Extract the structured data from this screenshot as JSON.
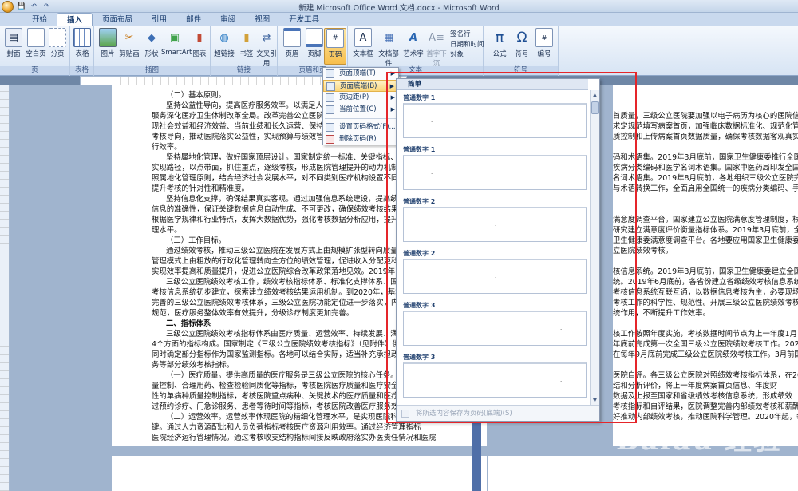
{
  "window": {
    "title": "新建 Microsoft Office Word 文档.docx - Microsoft Word"
  },
  "quick_access": {
    "save": "💾",
    "undo": "↶",
    "redo": "↷"
  },
  "tabs": [
    "开始",
    "插入",
    "页面布局",
    "引用",
    "邮件",
    "审阅",
    "视图",
    "开发工具"
  ],
  "active_tab": "插入",
  "ribbon": {
    "pages_group": {
      "label": "页",
      "cover": "封面",
      "blank": "空白页",
      "break": "分页"
    },
    "table_group": {
      "label": "表格",
      "table": "表格"
    },
    "illustrations_group": {
      "label": "插图",
      "picture": "图片",
      "clipart": "剪贴画",
      "shapes": "形状",
      "smartart": "SmartArt",
      "chart": "图表"
    },
    "links_group": {
      "label": "链接",
      "hyperlink": "超链接",
      "bookmark": "书签",
      "crossref": "交叉引用"
    },
    "header_group": {
      "label": "页眉和页",
      "header": "页眉",
      "footer": "页脚",
      "pagenum": "页码"
    },
    "text_group": {
      "label": "文本",
      "textbox": "文本框",
      "quickparts": "文档部件",
      "wordart": "艺术字",
      "dropcap": "首字下沉",
      "signature": "签名行",
      "datetime": "日期和时间",
      "object": "对象"
    },
    "symbols_group": {
      "label": "符号",
      "equation": "公式",
      "symbol": "符号",
      "number": "编号"
    }
  },
  "page_number_menu": {
    "items": [
      {
        "label": "页面顶端(T)",
        "has_submenu": true
      },
      {
        "label": "页面底端(B)",
        "has_submenu": true,
        "highlighted": true
      },
      {
        "label": "页边距(P)",
        "has_submenu": true
      },
      {
        "label": "当前位置(C)",
        "has_submenu": true
      },
      {
        "label": "设置页码格式(F)...",
        "has_submenu": false
      },
      {
        "label": "删除页码(R)",
        "has_submenu": false
      }
    ]
  },
  "gallery": {
    "category": "简单",
    "items": [
      {
        "label": "普通数字 1",
        "align": "left"
      },
      {
        "label": "普通数字 1",
        "align": "left"
      },
      {
        "label": "普通数字 2",
        "align": "center"
      },
      {
        "label": "普通数字 2",
        "align": "center"
      },
      {
        "label": "普通数字 3",
        "align": "right"
      },
      {
        "label": "普通数字 3",
        "align": "right"
      }
    ],
    "footer": "将所选内容保存为页码(底端)(S)"
  },
  "document": {
    "left_lines": [
      {
        "text": "（二）基本原则。",
        "bold": false
      },
      {
        "text": "坚持公益性导向，提高医疗服务效率。以满足人民群众",
        "bold": false
      },
      {
        "text": "服务深化医疗卫生体制改革全局。改革完善公立医院运行",
        "bold": false
      },
      {
        "text": "现社会效益和经济效益、当前业绩和长久运营、保持平稳和",
        "bold": false
      },
      {
        "text": "考核导向，推动医院落实公益性，实现预算与绩效管理一体",
        "bold": false
      },
      {
        "text": "行效率。",
        "bold": false
      },
      {
        "text": "坚持属地化管理，做好国家顶层设计。国家制定统一标准、关键指标、体系架",
        "bold": false
      },
      {
        "text": "实现路径，以点带面，抓住重点，逐级考核，形成医院管理提升的动力机制。各省",
        "bold": false
      },
      {
        "text": "照属地化管理原则，结合经济社会发展水平，对不同类别医疗机构设置不同指标和权",
        "bold": false
      },
      {
        "text": "提升考核的针对性和精准度。",
        "bold": false
      },
      {
        "text": "坚持信息化支撑，确保结果真实客观。通过加强信息系统建设，提高绩效考核",
        "bold": false
      },
      {
        "text": "信息的准确性，保证关键数据信息自动生成、不可更改，确保绩效考核结果真实客",
        "bold": false
      },
      {
        "text": "根据医学规律和行业特点，发挥大数据优势，强化考核数据分析应用，提升医院科",
        "bold": false
      },
      {
        "text": "理水平。",
        "bold": false
      },
      {
        "text": "（三）工作目标。",
        "bold": false
      },
      {
        "text": "通过绩效考核，推动三级公立医院在发展方式上由规模扩张型转向质量效益型",
        "bold": false
      },
      {
        "text": "管理模式上由粗放的行政化管理转向全方位的绩效管理，促进收入分配更科学、更",
        "bold": false
      },
      {
        "text": "实现效率提高和质量提升，促进公立医院综合改革政策落地见效。2019年，在全",
        "bold": false
      },
      {
        "text": "三级公立医院绩效考核工作，绩效考核指标体系、标准化支撑体系、国家级和省级",
        "bold": false
      },
      {
        "text": "考核信息系统初步建立，探索建立绩效考核结果运用机制。到2020年，基本建立",
        "bold": false
      },
      {
        "text": "完善的三级公立医院绩效考核体系，三级公立医院功能定位进一步落实，内部管理",
        "bold": false
      },
      {
        "text": "规范，医疗服务整体效率有效提升，分级诊疗制度更加完善。",
        "bold": false
      },
      {
        "text": "二、指标体系",
        "bold": true
      },
      {
        "text": "三级公立医院绩效考核指标体系由医疗质量、运营效率、持续发展、满意度评",
        "bold": false
      },
      {
        "text": "4个方面的指标构成。国家制定《三级公立医院绩效考核指标》（见附件）供各地使",
        "bold": false
      },
      {
        "text": "同时确定部分指标作为国家监测指标。各地可以结合实际，适当补充承担政府指令",
        "bold": false
      },
      {
        "text": "务等部分绩效考核指标。",
        "bold": false
      },
      {
        "text": "（一）医疗质量。提供高质量的医疗服务是三级公立医院的核心任务。通过医",
        "bold": false
      },
      {
        "text": "量控制、合理用药、检查检验同质化等指标，考核医院医疗质量和医疗安全。通过",
        "bold": false
      },
      {
        "text": "性的单病种质量控制指标，考核医院重点病种、关键技术的医疗质量和医疗安全情",
        "bold": false
      },
      {
        "text": "过预约诊疗、门急诊服务、患者等待时间等指标，考核医院改善医疗服务效果。",
        "bold": false
      },
      {
        "text": "（二）运营效率。运营效率体现医院的精细化管理水平，是实现医院科学管理",
        "bold": false
      },
      {
        "text": "键。通过人力资源配比和人员负荷指标考核医疗资源利用效率。通过经济管理指标",
        "bold": false
      },
      {
        "text": "医院经济运行管理情况。通过考核收支结构指标间接反映政府落实办医责任情况和医院",
        "bold": false
      }
    ],
    "right_lines": [
      "首质量，三级公立医院要加强以电子病历为核心的医院信息",
      "求定规范填写病案首页，加强临床数据标准化、规范化管理。各",
      "质控制和上传病案首页数据质量，确保考核数据客观真实。",
      "",
      "码和术语集。2019年3月底前，国家卫生健康委推行全国统一",
      "疾病分类编码和医学名词术语集。国家中医药局印发全国统一的中医",
      "名词术语集。2019年8月底前，各地组织三级公立医院完成电子",
      "与术语转换工作，全面启用全国统一的疾病分类编码、手术操作编码",
      "",
      "",
      "满意度调查平台。国家建立公立医院满意度管理制度，根据满意度",
      "研究建立满意度评价衡量指标体系。2019年3月底前，全国三级公立",
      "卫生健康委满意度调查平台。各地要应用国家卫生健康委满意度调查",
      "立医院绩效考核。",
      "",
      "核信息系统。2019年3月底前，国家卫生健康委建立全国三级公立",
      "统。2019年6月底前，各省份建立省级绩效考核信息系统，与",
      "考核信息系统互联互通，以数据信息考核为主，必要现场复核为",
      "考核工作的科学性、规范性。开展三级公立医院绩效考核工作",
      "统作用，不断提升工作效率。",
      "",
      "核工作按照年度实施，考核数据时间节点为上一年度1月",
      "年底前完成第一次全国三级公立医院绩效考核工作。2020年起，",
      "在每年9月底前完成三级公立医院绩效考核工作。3月前国家卫生健委",
      "",
      "医院自评。各三级公立医院对照绩效考核指标体系，在2019年9",
      "结和分析评价，将上一年度病案首页信息、年度财",
      "数据及上报至国家和省级绩效考核信息系统，形成绩效",
      "考核指标和自评结果，医院调整完善内部绩效考核和薪酬分配方",
      "好推动内部绩效考核，推动医院科学管理。2020年起，每年1月底"
    ]
  },
  "watermark": {
    "brand": "Baidu 经验",
    "url": "jingyan.baidu.com"
  },
  "colors": {
    "highlight_border": "#e5252a",
    "menu_highlight": "#fbd67a",
    "ribbon_bg": "#d7e4f4"
  }
}
